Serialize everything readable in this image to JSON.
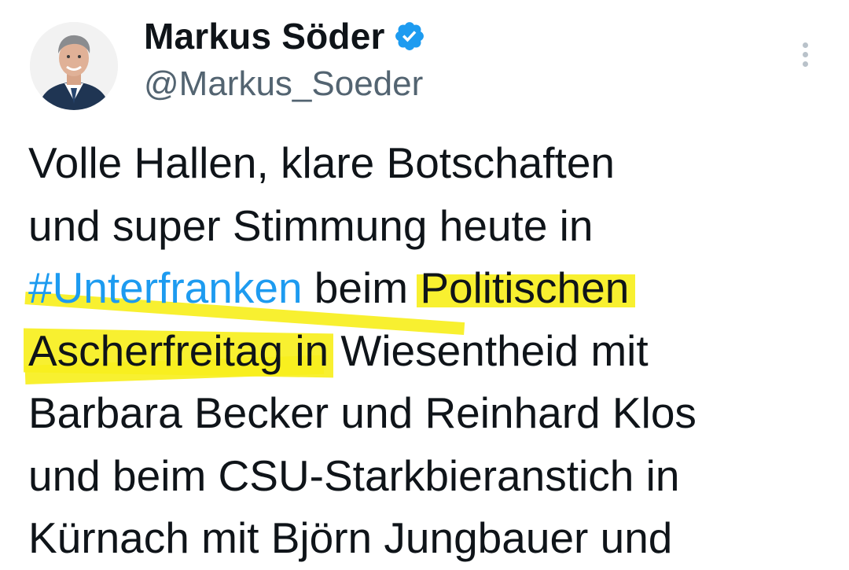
{
  "author": {
    "name": "Markus Söder",
    "handle": "@Markus_Soeder",
    "verified_icon": "verified-badge-icon",
    "avatar_icon": "profile-avatar"
  },
  "menu": {
    "icon": "more-vertical-icon"
  },
  "tweet": {
    "lines": [
      {
        "plain": "Volle Hallen, klare Botschaften"
      },
      {
        "plain": "und super Stimmung heute in"
      },
      {
        "hashtag": "#Unterfranken",
        "middle": " beim ",
        "highlight": "Politischen"
      },
      {
        "highlight": "Ascherfreitag in",
        "rest": " Wiesentheid mit"
      },
      {
        "plain": "Barbara Becker und Reinhard Klos"
      },
      {
        "plain": "und beim CSU-Starkbieranstich in"
      },
      {
        "plain": "Kürnach mit Björn Jungbauer und"
      }
    ]
  },
  "colors": {
    "text": "#0f1419",
    "secondary": "#536471",
    "link": "#1d9bf0",
    "highlighter": "#f7ef1e",
    "verified": "#1d9bf0"
  }
}
